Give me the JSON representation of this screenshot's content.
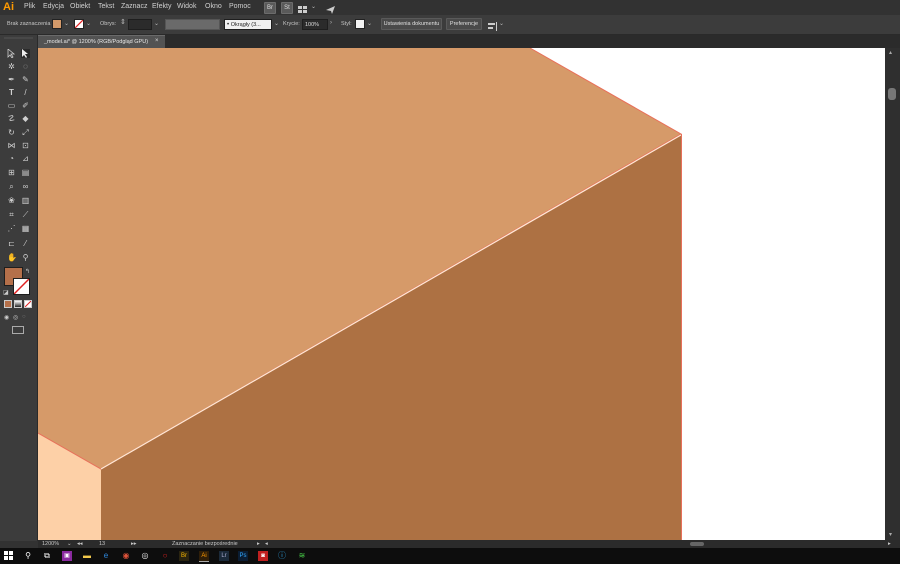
{
  "app": {
    "logo": "Ai"
  },
  "menu": [
    "Plik",
    "Edycja",
    "Obiekt",
    "Tekst",
    "Zaznacz",
    "Efekty",
    "Widok",
    "Okno",
    "Pomoc"
  ],
  "menu_icons": {
    "bridge": "Br",
    "stock": "St"
  },
  "control_bar": {
    "selection_label": "Brak zaznaczenia",
    "fill_color": "#d49a6a",
    "stroke_label": "Obrys:",
    "brush_label": "Okrągły (3...",
    "opacity_label": "Krycie:",
    "opacity_value": "100%",
    "style_label": "Styl:",
    "doc_setup_button": "Ustawienia dokumentu",
    "prefs_button": "Preferencje"
  },
  "document_tab": {
    "title": "_model.ai* @ 1200% (RGB/Podgląd GPU)",
    "close": "×"
  },
  "colors": {
    "fill_swatch": "#b5704a",
    "cube_top": "#d69a69",
    "cube_right": "#ad7143",
    "cube_left": "#fdd0a7",
    "edge_stroke": "#e8705a"
  },
  "status_bar": {
    "zoom": "1200%",
    "artboard": "13",
    "tool_name": "Zaznaczanie bezpośrednie"
  }
}
